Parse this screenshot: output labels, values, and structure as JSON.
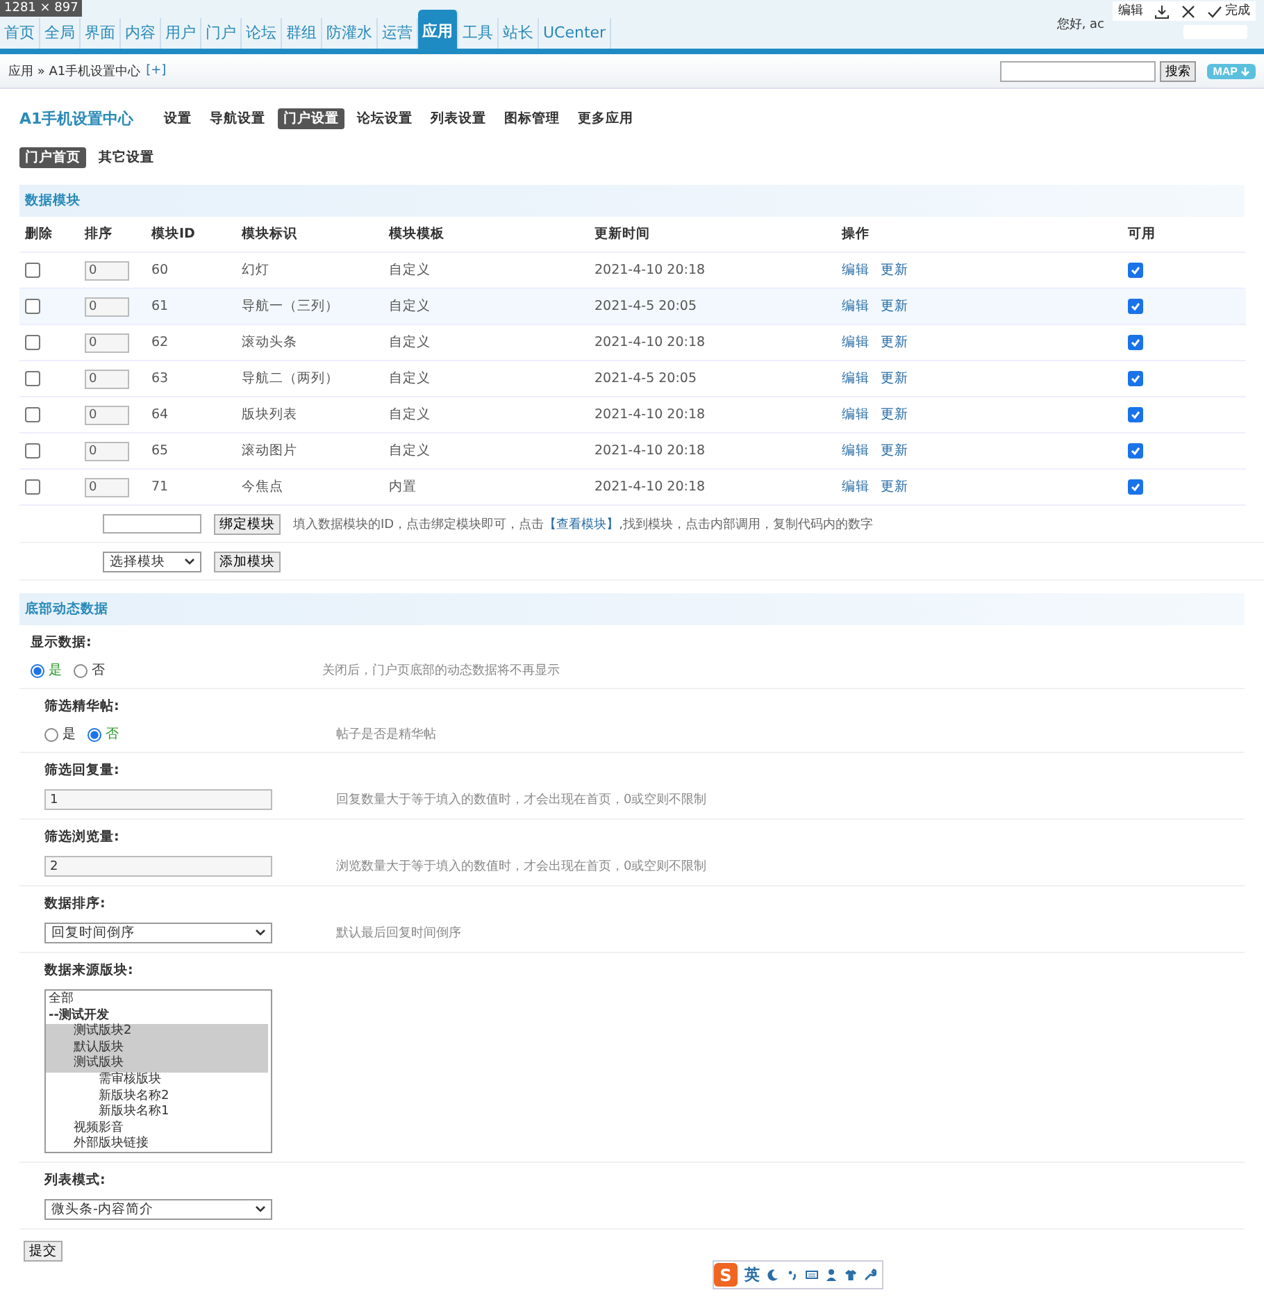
{
  "capture_overlay": {
    "size": "1281 × 897",
    "edit": "编辑",
    "done": "完成"
  },
  "topnav": {
    "items": [
      {
        "label": "首页",
        "selected": false
      },
      {
        "label": "全局",
        "selected": false
      },
      {
        "label": "界面",
        "selected": false
      },
      {
        "label": "内容",
        "selected": false
      },
      {
        "label": "用户",
        "selected": false
      },
      {
        "label": "门户",
        "selected": false
      },
      {
        "label": "论坛",
        "selected": false
      },
      {
        "label": "群组",
        "selected": false
      },
      {
        "label": "防灌水",
        "selected": false
      },
      {
        "label": "运营",
        "selected": false
      },
      {
        "label": "应用",
        "selected": true
      },
      {
        "label": "工具",
        "selected": false
      },
      {
        "label": "站长",
        "selected": false
      },
      {
        "label": "UCenter",
        "selected": false
      }
    ],
    "greeting": "您好, ac"
  },
  "breadcrumb": {
    "path": "应用 » A1手机设置中心",
    "add": "[+]",
    "search_button": "搜索",
    "map_button": "MAP"
  },
  "app": {
    "title": "A1手机设置中心",
    "tabs": [
      {
        "label": "设置",
        "selected": false
      },
      {
        "label": "导航设置",
        "selected": false
      },
      {
        "label": "门户设置",
        "selected": true
      },
      {
        "label": "论坛设置",
        "selected": false
      },
      {
        "label": "列表设置",
        "selected": false
      },
      {
        "label": "图标管理",
        "selected": false
      },
      {
        "label": "更多应用",
        "selected": false
      }
    ],
    "subtabs": [
      {
        "label": "门户首页",
        "selected": true
      },
      {
        "label": "其它设置",
        "selected": false
      }
    ]
  },
  "modules": {
    "title": "数据模块",
    "columns": [
      "删除",
      "排序",
      "模块ID",
      "模块标识",
      "模块模板",
      "更新时间",
      "操作",
      "可用"
    ],
    "rows": [
      {
        "delete": false,
        "order": "0",
        "id": "60",
        "name": "幻灯",
        "template": "自定义",
        "updated": "2021-4-10 20:18",
        "actions": [
          "编辑",
          "更新"
        ],
        "enabled": true,
        "highlighted": false
      },
      {
        "delete": false,
        "order": "0",
        "id": "61",
        "name": "导航一（三列）",
        "template": "自定义",
        "updated": "2021-4-5 20:05",
        "actions": [
          "编辑",
          "更新"
        ],
        "enabled": true,
        "highlighted": true
      },
      {
        "delete": false,
        "order": "0",
        "id": "62",
        "name": "滚动头条",
        "template": "自定义",
        "updated": "2021-4-10 20:18",
        "actions": [
          "编辑",
          "更新"
        ],
        "enabled": true,
        "highlighted": false
      },
      {
        "delete": false,
        "order": "0",
        "id": "63",
        "name": "导航二（两列）",
        "template": "自定义",
        "updated": "2021-4-5 20:05",
        "actions": [
          "编辑",
          "更新"
        ],
        "enabled": true,
        "highlighted": false
      },
      {
        "delete": false,
        "order": "0",
        "id": "64",
        "name": "版块列表",
        "template": "自定义",
        "updated": "2021-4-10 20:18",
        "actions": [
          "编辑",
          "更新"
        ],
        "enabled": true,
        "highlighted": false
      },
      {
        "delete": false,
        "order": "0",
        "id": "65",
        "name": "滚动图片",
        "template": "自定义",
        "updated": "2021-4-10 20:18",
        "actions": [
          "编辑",
          "更新"
        ],
        "enabled": true,
        "highlighted": false
      },
      {
        "delete": false,
        "order": "0",
        "id": "71",
        "name": "今焦点",
        "template": "内置",
        "updated": "2021-4-10 20:18",
        "actions": [
          "编辑",
          "更新"
        ],
        "enabled": true,
        "highlighted": false
      }
    ],
    "bind_button": "绑定模块",
    "bind_hint_before": "填入数据模块的ID，点击绑定模块即可，点击",
    "bind_hint_link": "【查看模块】",
    "bind_hint_after": ",找到模块，点击内部调用，复制代码内的数字",
    "select_value": "选择模块",
    "add_button": "添加模块"
  },
  "footer_data": {
    "title": "底部动态数据",
    "fields": [
      {
        "kind": "radio",
        "label": "显示数据:",
        "indented": false,
        "options": [
          {
            "label": "是",
            "selected": true
          },
          {
            "label": "否",
            "selected": false
          }
        ],
        "hint": "关闭后，门户页底部的动态数据将不再显示"
      },
      {
        "kind": "radio",
        "label": "筛选精华帖:",
        "indented": true,
        "options": [
          {
            "label": "是",
            "selected": false
          },
          {
            "label": "否",
            "selected": true
          }
        ],
        "hint": "帖子是否是精华帖"
      },
      {
        "kind": "text",
        "label": "筛选回复量:",
        "indented": true,
        "value": "1",
        "hint": "回复数量大于等于填入的数值时，才会出现在首页，0或空则不限制"
      },
      {
        "kind": "text",
        "label": "筛选浏览量:",
        "indented": true,
        "value": "2",
        "hint": "浏览数量大于等于填入的数值时，才会出现在首页，0或空则不限制"
      },
      {
        "kind": "select",
        "label": "数据排序:",
        "indented": true,
        "value": "回复时间倒序",
        "hint": "默认最后回复时间倒序"
      },
      {
        "kind": "multiselect",
        "label": "数据来源版块:",
        "indented": true,
        "options": [
          {
            "kind": "option",
            "label": "全部",
            "selected": false
          },
          {
            "kind": "group",
            "label": "--测试开发",
            "selected": false,
            "children": [
              {
                "kind": "option",
                "label": "测试版块2",
                "selected": true
              },
              {
                "kind": "option",
                "label": "默认版块",
                "selected": true
              },
              {
                "kind": "option",
                "label": "测试版块",
                "selected": true,
                "children": [
                  {
                    "kind": "option",
                    "label": "需审核版块",
                    "selected": false
                  },
                  {
                    "kind": "option",
                    "label": "新版块名称2",
                    "selected": false
                  },
                  {
                    "kind": "option",
                    "label": "新版块名称1",
                    "selected": false
                  }
                ]
              },
              {
                "kind": "option",
                "label": "视频影音",
                "selected": false
              },
              {
                "kind": "option",
                "label": "外部版块链接",
                "selected": false
              }
            ]
          }
        ]
      },
      {
        "kind": "select",
        "label": "列表模式:",
        "indented": true,
        "value": "微头条-内容简介"
      }
    ],
    "submit": "提交"
  },
  "ime_toolbar": {
    "logo": "S",
    "language": "英"
  }
}
